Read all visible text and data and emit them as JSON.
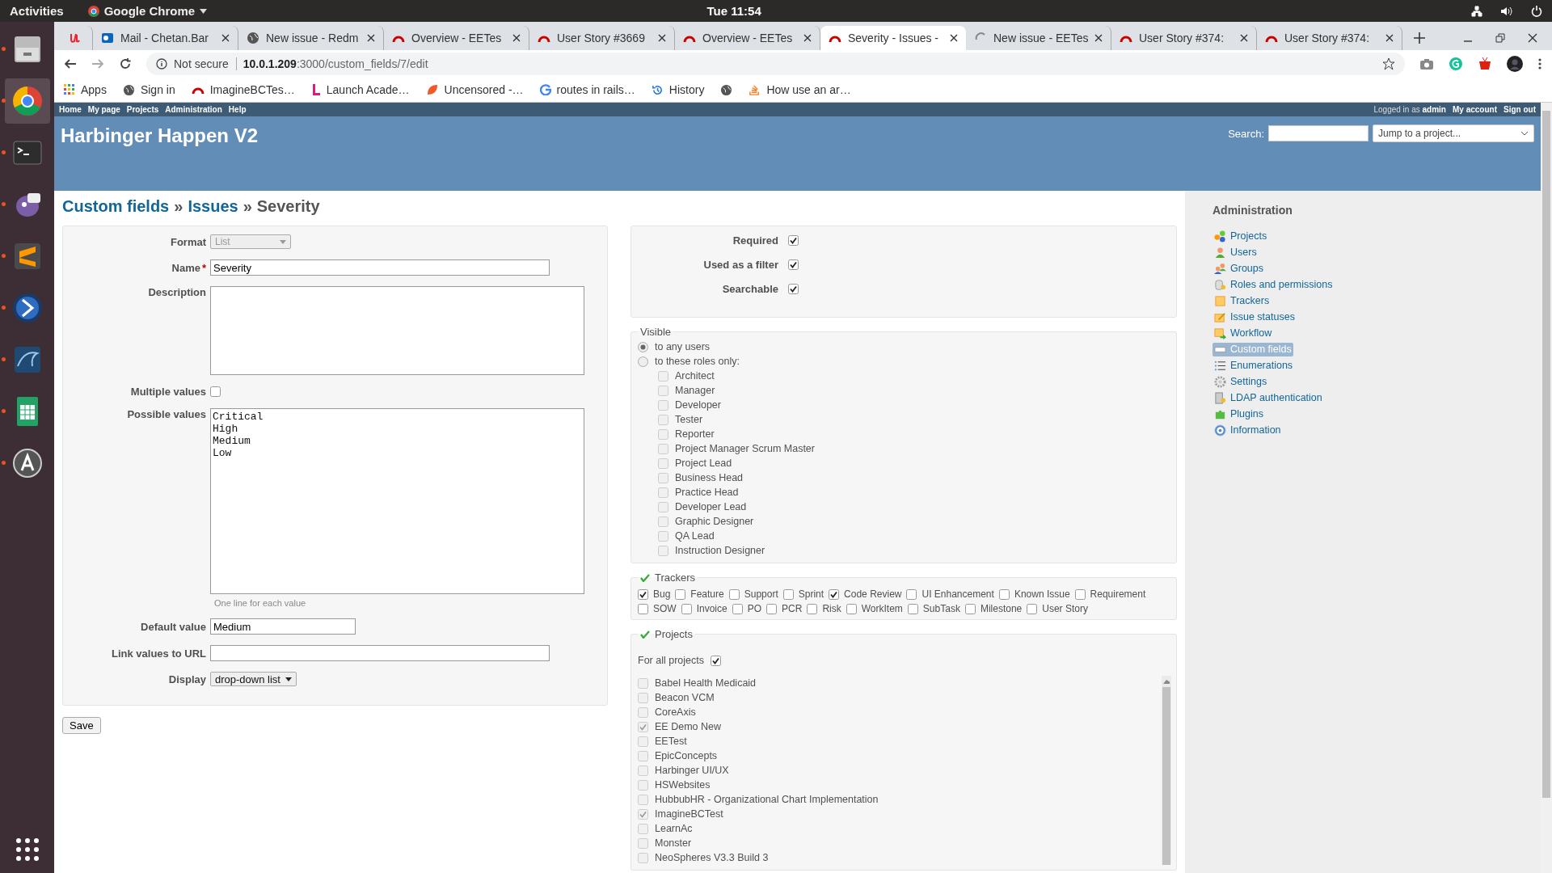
{
  "topbar": {
    "activities": "Activities",
    "app": "Google Chrome",
    "clock": "Tue 11:54"
  },
  "dock": [
    {
      "kind": "files",
      "running": true,
      "selected": false
    },
    {
      "kind": "chrome",
      "running": true,
      "selected": true
    },
    {
      "kind": "terminal",
      "running": true,
      "selected": false
    },
    {
      "kind": "bird",
      "running": true,
      "selected": false
    },
    {
      "kind": "editor",
      "running": true,
      "selected": false
    },
    {
      "kind": "circle",
      "running": true,
      "selected": false
    },
    {
      "kind": "dolphin",
      "running": true,
      "selected": false
    },
    {
      "kind": "sheet",
      "running": true,
      "selected": false
    },
    {
      "kind": "updater",
      "running": true,
      "selected": false
    }
  ],
  "browser": {
    "tabs": [
      {
        "kind": "u",
        "selected": false
      },
      {
        "kind": "mail",
        "title": "Mail - Chetan.Bar",
        "selected": false
      },
      {
        "kind": "globe",
        "title": "New issue - Redm",
        "selected": false
      },
      {
        "kind": "arc",
        "title": "Overview - EETes",
        "selected": false
      },
      {
        "kind": "arc",
        "title": "User Story #3669",
        "selected": false
      },
      {
        "kind": "arc",
        "title": "Overview - EETes",
        "selected": false
      },
      {
        "kind": "arc",
        "title": "Severity - Issues -",
        "selected": true
      },
      {
        "kind": "spinner",
        "title": "New issue - EETes",
        "selected": false
      },
      {
        "kind": "arc",
        "title": "User Story #374:",
        "selected": false
      },
      {
        "kind": "arc",
        "title": "User Story #374:",
        "selected": false
      }
    ],
    "security": "Not secure",
    "url_host": "10.0.1.209",
    "url_rest": ":3000/custom_fields/7/edit",
    "bookmarks": [
      {
        "kind": "apps",
        "label": "Apps"
      },
      {
        "kind": "globe",
        "label": "Sign in"
      },
      {
        "kind": "arc",
        "label": "ImagineBCTes…"
      },
      {
        "kind": "l",
        "label": "Launch Acade…"
      },
      {
        "kind": "leaf",
        "label": "Uncensored -…"
      },
      {
        "kind": "g",
        "label": "routes in rails…"
      },
      {
        "kind": "history",
        "label": "History"
      },
      {
        "kind": "globe"
      },
      {
        "kind": "stack",
        "label": "How use an ar…"
      }
    ]
  },
  "top_menu": [
    "Home",
    "My page",
    "Projects",
    "Administration",
    "Help"
  ],
  "account": {
    "logged_in": "Logged in as **admin**",
    "links": [
      "My account",
      "Sign out"
    ]
  },
  "header": {
    "title": "Harbinger Happen V2",
    "search_label": "Search:",
    "jump": "Jump to a project..."
  },
  "breadcrumb": {
    "links": [
      "Custom fields",
      "Issues"
    ],
    "separator": "»",
    "current": "Severity"
  },
  "form": {
    "format": {
      "label": "Format",
      "value": "List",
      "disabled": true
    },
    "name": {
      "label": "Name",
      "required": "*",
      "value": "Severity"
    },
    "description": {
      "label": "Description"
    },
    "multiple": {
      "label": "Multiple values",
      "checked": false
    },
    "possible": {
      "label": "Possible values",
      "value": "Critical\nHigh\nMedium\nLow",
      "hint": "One line for each value"
    },
    "default": {
      "label": "Default value",
      "value": "Medium"
    },
    "url": {
      "label": "Link values to URL"
    },
    "display": {
      "label": "Display",
      "value": "drop-down list"
    },
    "save": "Save"
  },
  "flags": [
    {
      "label": "Required",
      "checked": true
    },
    {
      "label": "Used as a filter",
      "checked": true
    },
    {
      "label": "Searchable",
      "checked": true
    }
  ],
  "visible": {
    "legend": "Visible",
    "options": [
      {
        "label": "to any users",
        "selected": true
      },
      {
        "label": "to these roles only:",
        "selected": false
      }
    ],
    "roles_disabled": true,
    "roles": [
      {
        "label": "Architect",
        "checked": false
      },
      {
        "label": "Manager",
        "checked": false
      },
      {
        "label": "Developer",
        "checked": false
      },
      {
        "label": "Tester",
        "checked": false
      },
      {
        "label": "Reporter",
        "checked": false
      },
      {
        "label": "Project Manager Scrum Master",
        "checked": false
      },
      {
        "label": "Project Lead",
        "checked": false
      },
      {
        "label": "Business Head",
        "checked": false
      },
      {
        "label": "Practice Head",
        "checked": false
      },
      {
        "label": "Developer Lead",
        "checked": false
      },
      {
        "label": "Graphic Designer",
        "checked": false
      },
      {
        "label": "QA Lead",
        "checked": false
      },
      {
        "label": "Instruction Designer",
        "checked": false
      }
    ]
  },
  "trackers": {
    "legend": "Trackers",
    "items": [
      {
        "label": "Bug",
        "checked": true
      },
      {
        "label": "Feature",
        "checked": false
      },
      {
        "label": "Support",
        "checked": false
      },
      {
        "label": "Sprint",
        "checked": false
      },
      {
        "label": "Code Review",
        "checked": true
      },
      {
        "label": "UI Enhancement",
        "checked": false
      },
      {
        "label": "Known Issue",
        "checked": false
      },
      {
        "label": "Requirement",
        "checked": false
      },
      {
        "label": "SOW",
        "checked": false
      },
      {
        "label": "Invoice",
        "checked": false
      },
      {
        "label": "PO",
        "checked": false
      },
      {
        "label": "PCR",
        "checked": false
      },
      {
        "label": "Risk",
        "checked": false
      },
      {
        "label": "WorkItem",
        "checked": false
      },
      {
        "label": "SubTask",
        "checked": false
      },
      {
        "label": "Milestone",
        "checked": false
      },
      {
        "label": "User Story",
        "checked": false
      }
    ]
  },
  "projects": {
    "legend": "Projects",
    "for_all": {
      "label": "For all projects",
      "checked": true
    },
    "list_disabled": true,
    "items": [
      {
        "label": "Babel Health Medicaid",
        "checked": false
      },
      {
        "label": "Beacon VCM",
        "checked": false
      },
      {
        "label": "CoreAxis",
        "checked": false
      },
      {
        "label": "EE Demo New",
        "checked": true
      },
      {
        "label": "EETest",
        "checked": false
      },
      {
        "label": "EpicConcepts",
        "checked": false
      },
      {
        "label": "Harbinger UI/UX",
        "checked": false
      },
      {
        "label": "HSWebsites",
        "checked": false
      },
      {
        "label": "HubbubHR - Organizational Chart Implementation",
        "checked": false
      },
      {
        "label": "ImagineBCTest",
        "checked": true
      },
      {
        "label": "LearnAc",
        "checked": false
      },
      {
        "label": "Monster",
        "checked": false
      },
      {
        "label": "NeoSpheres V3.3 Build 3",
        "checked": false
      }
    ]
  },
  "sidebar": {
    "title": "Administration",
    "items": [
      {
        "kind": "projects",
        "label": "Projects",
        "selected": false
      },
      {
        "kind": "user",
        "label": "Users",
        "selected": false
      },
      {
        "kind": "group",
        "label": "Groups",
        "selected": false
      },
      {
        "kind": "key",
        "label": "Roles and permissions",
        "selected": false
      },
      {
        "kind": "tracker",
        "label": "Trackers",
        "selected": false
      },
      {
        "kind": "status",
        "label": "Issue statuses",
        "selected": false
      },
      {
        "kind": "workflow",
        "label": "Workflow",
        "selected": false
      },
      {
        "kind": "field",
        "label": "Custom fields",
        "selected": true
      },
      {
        "kind": "list",
        "label": "Enumerations",
        "selected": false
      },
      {
        "kind": "gear",
        "label": "Settings",
        "selected": false
      },
      {
        "kind": "server",
        "label": "LDAP authentication",
        "selected": false
      },
      {
        "kind": "puzzle",
        "label": "Plugins",
        "selected": false
      },
      {
        "kind": "info",
        "label": "Information",
        "selected": false
      }
    ]
  }
}
